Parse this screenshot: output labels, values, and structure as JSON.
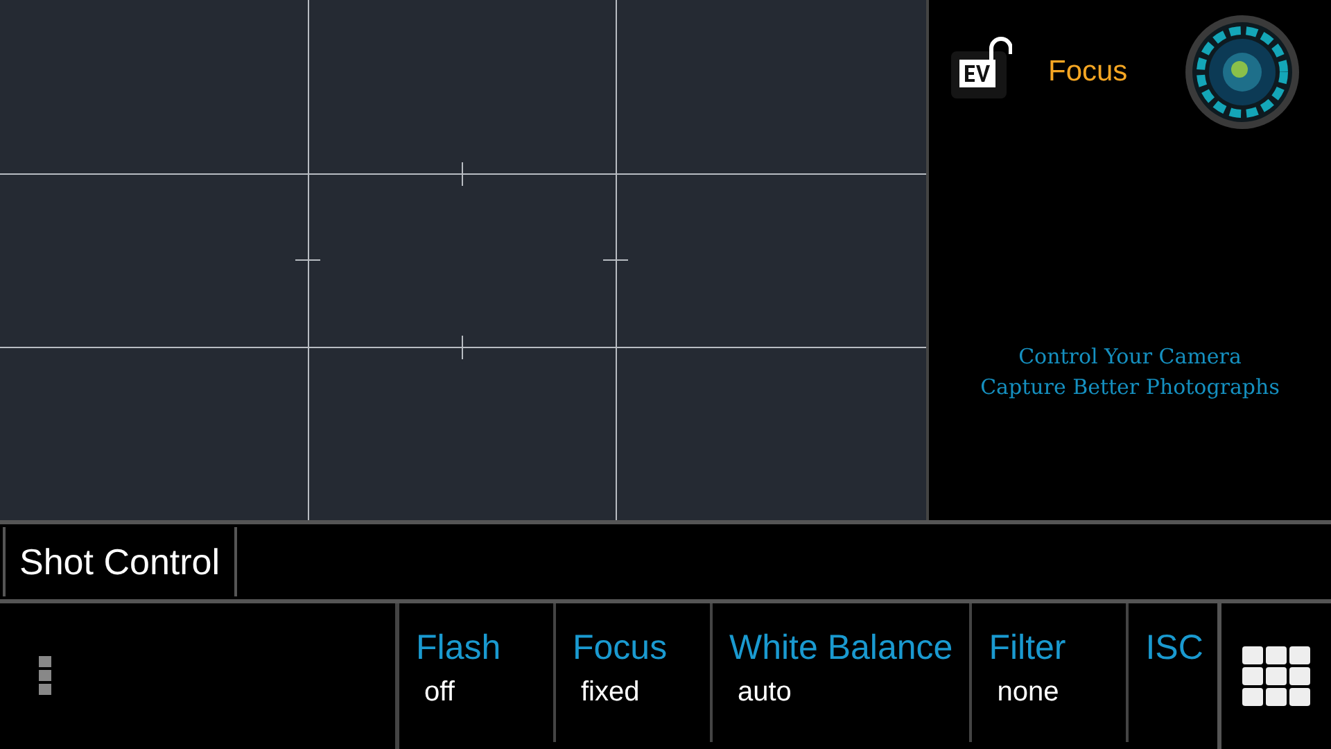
{
  "top_panel": {
    "mode_label": "Focus",
    "tagline": [
      "Control Your Camera",
      "Capture Better Photographs"
    ]
  },
  "shot_control": {
    "label": "Shot Control"
  },
  "settings": [
    {
      "label": "Flash",
      "value": "off"
    },
    {
      "label": "Focus",
      "value": "fixed"
    },
    {
      "label": "White Balance",
      "value": "auto"
    },
    {
      "label": "Filter",
      "value": "none"
    },
    {
      "label": "ISC"
    }
  ]
}
